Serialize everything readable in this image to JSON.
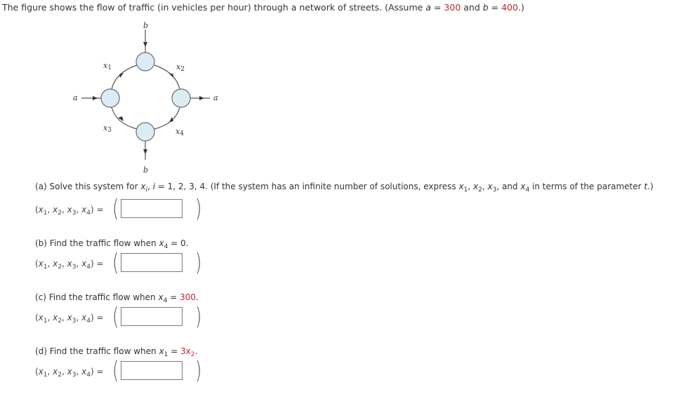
{
  "intro": {
    "prefix": "The figure shows the flow of traffic (in vehicles per hour) through a network of streets. (Assume ",
    "a_var": "a",
    "eq1": " = ",
    "a_value": "300",
    "and": " and ",
    "b_var": "b",
    "eq2": " = ",
    "b_value": "400",
    "suffix": ".)"
  },
  "figure": {
    "labels": {
      "b_top": "b",
      "b_bottom": "b",
      "a_left": "a",
      "a_right": "a",
      "x1": "x",
      "x1_sub": "1",
      "x2": "x",
      "x2_sub": "2",
      "x3": "x",
      "x3_sub": "3",
      "x4": "x",
      "x4_sub": "4"
    },
    "node_fill": "#dcecf5",
    "node_stroke": "#6b6b6b"
  },
  "tuple_label": {
    "open": "(",
    "x": "x",
    "s1": "1",
    "s2": "2",
    "s3": "3",
    "s4": "4",
    "sep": ", ",
    "close": ") ="
  },
  "parts": [
    {
      "id": "a",
      "prefix": "(a) Solve this system for ",
      "xi": "x",
      "xi_sub": "i",
      "mid": ", ",
      "i_var": "i",
      "rest1": " = 1, 2, 3, 4.  (If the system has an infinite number of solutions, express ",
      "x": "x",
      "s1": "1",
      "s2": "2",
      "s3": "3",
      "s4": "4",
      "comma": ", ",
      "and": ", and ",
      "rest2": " in terms of the parameter ",
      "t": "t",
      "end": ".)",
      "answer": ""
    },
    {
      "id": "b",
      "prefix": "(b) Find the traffic flow when ",
      "cond_var": "x",
      "cond_sub": "4",
      "cond_eq": " = 0.",
      "answer": ""
    },
    {
      "id": "c",
      "prefix": "(c) Find the traffic flow when ",
      "cond_var": "x",
      "cond_sub": "4",
      "cond_eq": " = ",
      "cond_value": "300",
      "cond_end": ".",
      "answer": ""
    },
    {
      "id": "d",
      "prefix": "(d) Find the traffic flow when ",
      "cond_var": "x",
      "cond_sub": "1",
      "cond_eq": " = ",
      "cond_value": "3x",
      "cond_value_sub": "2",
      "cond_end": ".",
      "answer": ""
    }
  ]
}
